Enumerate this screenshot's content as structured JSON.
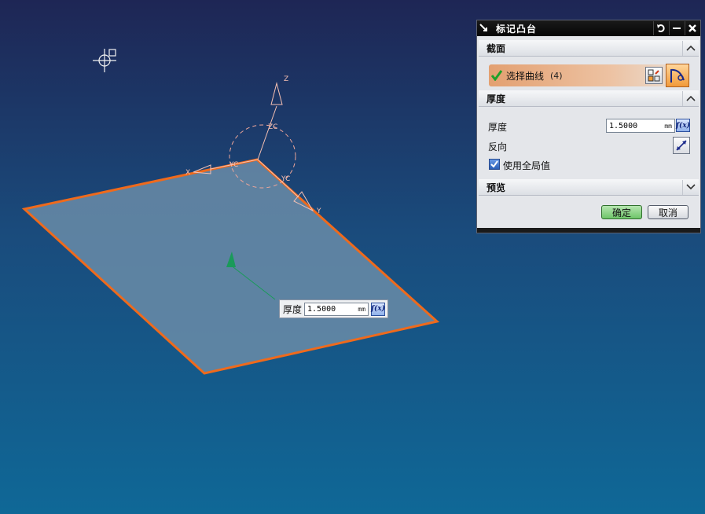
{
  "dialog": {
    "title": "标记凸台",
    "section_section": {
      "title": "截面"
    },
    "select_curve": {
      "label": "选择曲线",
      "count": "(4)"
    },
    "section_thickness": {
      "title": "厚度"
    },
    "thickness": {
      "label": "厚度",
      "value": "1.5000",
      "unit": "mm",
      "fx": "f(x)"
    },
    "reverse": {
      "label": "反向"
    },
    "use_global": {
      "label": "使用全局值",
      "checked": true
    },
    "section_preview": {
      "title": "预览"
    },
    "buttons": {
      "ok": "确定",
      "cancel": "取消"
    }
  },
  "onscreen_input": {
    "label": "厚度",
    "value": "1.5000",
    "unit": "mm",
    "fx": "f(x)"
  },
  "viewport": {
    "axis_labels": {
      "z": "Z",
      "zc": "ZC",
      "yc_upper": "YC",
      "yc_lower": "YC",
      "x": "X",
      "y": "Y"
    }
  },
  "colors": {
    "plane_fill": "#6a8ca8",
    "plane_edge": "#ef6a1c",
    "normal_arrow": "#1a9a5a",
    "selection_highlight": "#e3a071"
  }
}
